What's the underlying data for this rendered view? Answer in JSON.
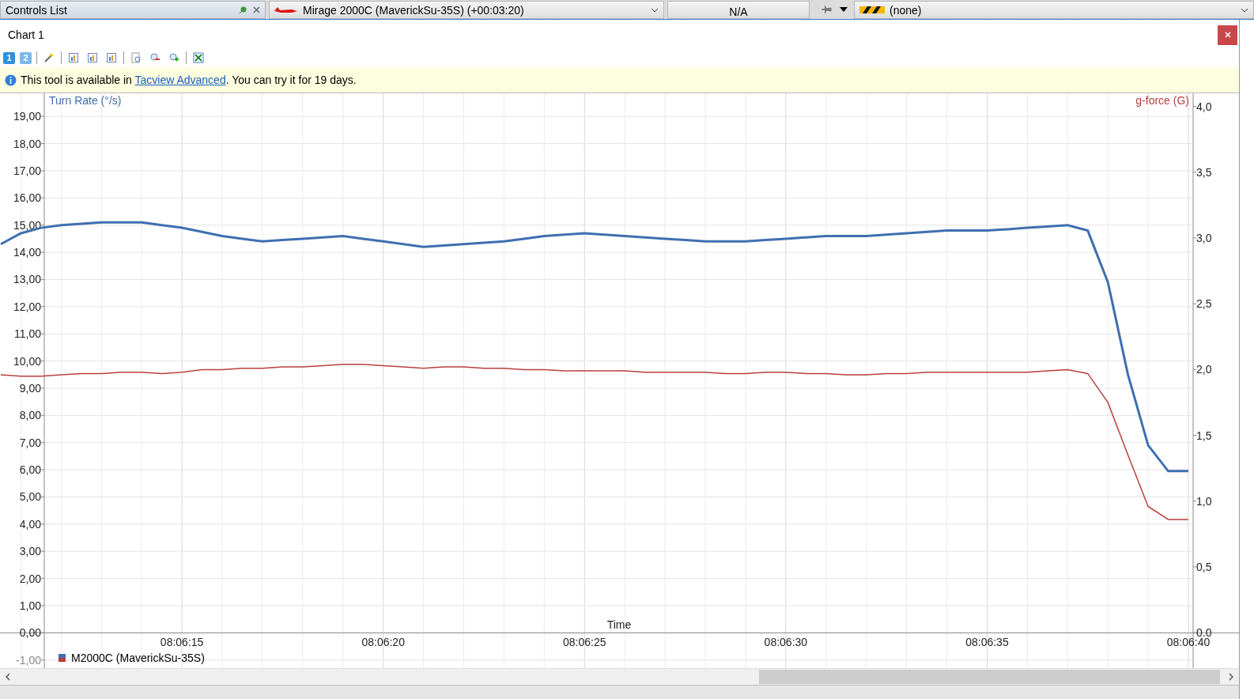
{
  "top_bar": {
    "panel_title": "Controls List",
    "aircraft": "Mirage 2000C (MaverickSu-35S) (+00:03:20)",
    "status": "N/A",
    "target": "(none)"
  },
  "chart_window": {
    "title": "Chart 1",
    "pages": [
      {
        "label": "1",
        "selected": true
      },
      {
        "label": "2",
        "selected": false
      }
    ],
    "notice": {
      "before": "This tool is available in ",
      "link": "Tacview Advanced",
      "after": ". You can try it for 19 days."
    },
    "legend": "M2000C (MaverickSu-35S)",
    "chart_data": {
      "type": "line",
      "xlabel": "Time",
      "categories": [
        null,
        null,
        null,
        null,
        null,
        null,
        null,
        null,
        null,
        "08:06:15",
        null,
        null,
        null,
        null,
        null,
        null,
        null,
        null,
        null,
        "08:06:20",
        null,
        null,
        null,
        null,
        null,
        null,
        null,
        null,
        null,
        "08:06:25",
        null,
        null,
        null,
        null,
        null,
        null,
        null,
        null,
        null,
        "08:06:30",
        null,
        null,
        null,
        null,
        null,
        null,
        null,
        null,
        null,
        "08:06:35",
        null,
        null,
        null,
        null,
        null,
        null,
        null,
        null,
        null,
        "08:06:40"
      ],
      "ylim": [
        -1.3,
        19.85
      ],
      "y2lim": [
        -0.27,
        4.1
      ],
      "grid": true,
      "yticks": [
        {
          "value": -1,
          "label": "-1,00"
        },
        {
          "value": 0,
          "label": "0,00"
        },
        {
          "value": 1,
          "label": "1,00"
        },
        {
          "value": 2,
          "label": "2,00"
        },
        {
          "value": 3,
          "label": "3,00"
        },
        {
          "value": 4,
          "label": "4,00"
        },
        {
          "value": 5,
          "label": "5,00"
        },
        {
          "value": 6,
          "label": "6,00"
        },
        {
          "value": 7,
          "label": "7,00"
        },
        {
          "value": 8,
          "label": "8,00"
        },
        {
          "value": 9,
          "label": "9,00"
        },
        {
          "value": 10,
          "label": "10,00"
        },
        {
          "value": 11,
          "label": "11,00"
        },
        {
          "value": 12,
          "label": "12,00"
        },
        {
          "value": 13,
          "label": "13,00"
        },
        {
          "value": 14,
          "label": "14,00"
        },
        {
          "value": 15,
          "label": "15,00"
        },
        {
          "value": 16,
          "label": "16,00"
        },
        {
          "value": 17,
          "label": "17,00"
        },
        {
          "value": 18,
          "label": "18,00"
        },
        {
          "value": 19,
          "label": "19,00"
        }
      ],
      "y2ticks": [
        {
          "value": 0,
          "label": "0.0"
        },
        {
          "value": 0.5,
          "label": "0,5"
        },
        {
          "value": 1,
          "label": "1,0"
        },
        {
          "value": 1.5,
          "label": "1,5"
        },
        {
          "value": 2,
          "label": "2,0"
        },
        {
          "value": 2.5,
          "label": "2,5"
        },
        {
          "value": 3,
          "label": "3,0"
        },
        {
          "value": 3.5,
          "label": "3,5"
        },
        {
          "value": 4,
          "label": "4,0"
        }
      ],
      "series": [
        {
          "name": "Turn Rate (°/s)",
          "color": "#3f6fb0",
          "values": [
            14.3,
            14.7,
            14.9,
            15.0,
            15.05,
            15.1,
            15.1,
            15.1,
            15.0,
            14.9,
            14.75,
            14.6,
            14.5,
            14.4,
            14.45,
            14.5,
            14.55,
            14.6,
            14.5,
            14.4,
            14.3,
            14.2,
            14.25,
            14.3,
            14.35,
            14.4,
            14.5,
            14.6,
            14.65,
            14.7,
            14.65,
            14.6,
            14.55,
            14.5,
            14.45,
            14.4,
            14.4,
            14.4,
            14.45,
            14.5,
            14.55,
            14.6,
            14.6,
            14.6,
            14.65,
            14.7,
            14.75,
            14.8,
            14.8,
            14.8,
            14.85,
            14.9,
            14.95,
            15.0,
            14.8,
            12.9,
            9.5,
            6.9,
            5.95,
            5.95
          ]
        },
        {
          "name": "g-force (G)",
          "color": "#b8403c",
          "axis": "y2",
          "values": [
            1.96,
            1.95,
            1.95,
            1.96,
            1.97,
            1.97,
            1.98,
            1.98,
            1.97,
            1.98,
            2.0,
            2.0,
            2.01,
            2.01,
            2.02,
            2.02,
            2.03,
            2.04,
            2.04,
            2.03,
            2.02,
            2.01,
            2.02,
            2.02,
            2.01,
            2.01,
            2.0,
            2.0,
            1.99,
            1.99,
            1.99,
            1.99,
            1.98,
            1.98,
            1.98,
            1.98,
            1.97,
            1.97,
            1.98,
            1.98,
            1.97,
            1.97,
            1.96,
            1.96,
            1.97,
            1.97,
            1.98,
            1.98,
            1.98,
            1.98,
            1.98,
            1.98,
            1.99,
            2.0,
            1.97,
            1.75,
            1.35,
            0.96,
            0.86,
            0.86
          ]
        }
      ]
    }
  }
}
